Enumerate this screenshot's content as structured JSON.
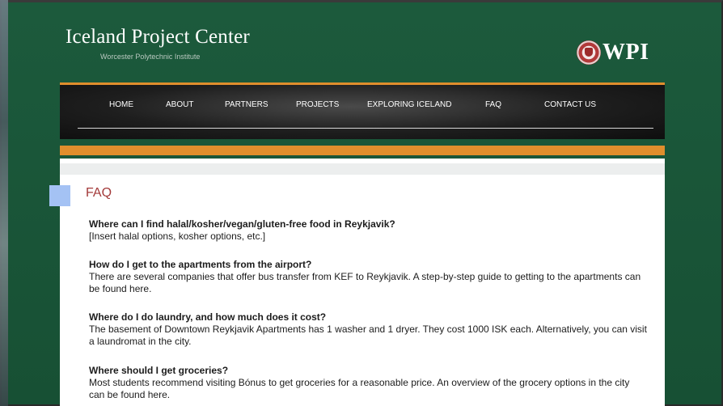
{
  "header": {
    "title": "Iceland Project Center",
    "subtitle": "Worcester Polytechnic Institute",
    "logo_text": "WPI"
  },
  "nav": {
    "items": [
      {
        "label": "HOME"
      },
      {
        "label": "ABOUT"
      },
      {
        "label": "PARTNERS"
      },
      {
        "label": "PROJECTS"
      },
      {
        "label": "EXPLORING ICELAND"
      },
      {
        "label": "FAQ"
      },
      {
        "label": "CONTACT US"
      }
    ]
  },
  "main": {
    "heading": "FAQ",
    "faqs": [
      {
        "question": "Where can I find halal/kosher/vegan/gluten-free food in Reykjavik?",
        "answer": "[Insert halal options, kosher options, etc.]"
      },
      {
        "question": "How do I get to the apartments from the airport?",
        "answer": "There are several companies that offer bus transfer from KEF to Reykjavik. A step-by-step guide to getting to the apartments can be found here."
      },
      {
        "question": "Where do I do laundry, and how much does it cost?",
        "answer": "The basement of Downtown Reykjavik Apartments has 1 washer and 1 dryer. They cost 1000 ISK each. Alternatively, you can visit a laundromat in the city."
      },
      {
        "question": "Where should I get groceries?",
        "answer": "Most students recommend visiting Bónus to get groceries for a reasonable price. An overview of the grocery options in the city can be found here."
      }
    ]
  },
  "colors": {
    "background": "#1a5238",
    "accent": "#e08e2d",
    "heading": "#a33a3a",
    "marker": "#a4c2f4"
  },
  "icons": {
    "logo": "university-seal-icon"
  }
}
